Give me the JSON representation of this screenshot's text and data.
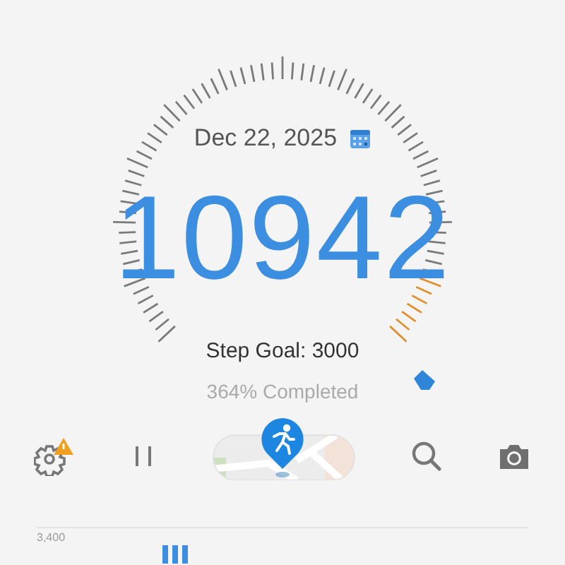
{
  "date": "Dec 22, 2025",
  "steps": "10942",
  "goal": "Step Goal: 3000",
  "completed": "364% Completed",
  "toolbar": {
    "settings_warning": true
  },
  "chart": {
    "axis_label": "3,400"
  }
}
